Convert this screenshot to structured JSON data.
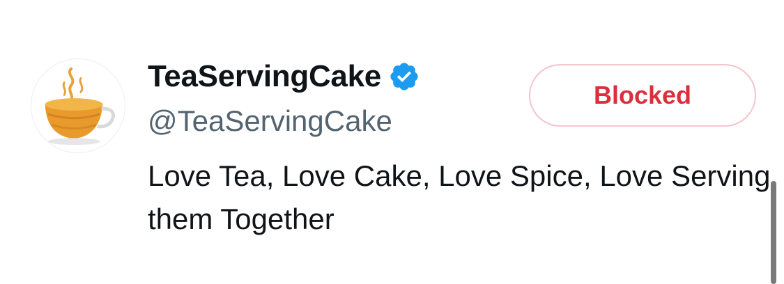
{
  "profile": {
    "display_name": "TeaServingCake",
    "handle": "@TeaServingCake",
    "bio": "Love Tea, Love Cake, Love Spice, Love Serving them Together",
    "verified": true,
    "avatar_icon": "tea-cup-icon"
  },
  "action": {
    "label": "Blocked",
    "color": "#d9303c",
    "border_color": "#f4c5ca"
  },
  "colors": {
    "verified_badge": "#1d9bf0",
    "handle": "#536471",
    "text": "#0f1419"
  }
}
